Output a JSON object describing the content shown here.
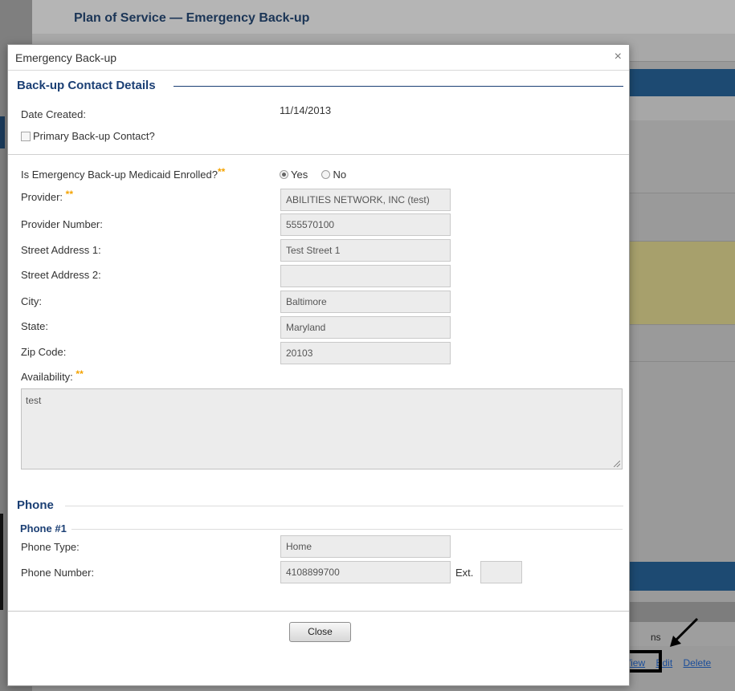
{
  "background": {
    "page_title": "Plan of Service — Emergency Back-up",
    "column_header_fragment": "ns",
    "row_links": {
      "view": "k View",
      "edit": "Edit",
      "delete": "Delete"
    }
  },
  "modal": {
    "title": "Emergency Back-up",
    "close_icon": "×",
    "section_contact": "Back-up Contact Details",
    "date_created_label": "Date Created:",
    "date_created_value": "11/14/2013",
    "primary_label": "Primary Back-up Contact?",
    "medicaid_label": "Is Emergency Back-up Medicaid Enrolled?",
    "required_mark": "**",
    "radio_yes": "Yes",
    "radio_no": "No",
    "radio_selected": "Yes",
    "fields": {
      "provider_label": "Provider:",
      "provider_value": "ABILITIES NETWORK, INC (test)",
      "provider_number_label": "Provider Number:",
      "provider_number_value": "555570100",
      "street1_label": "Street Address 1:",
      "street1_value": "Test Street 1",
      "street2_label": "Street Address 2:",
      "street2_value": "",
      "city_label": "City:",
      "city_value": "Baltimore",
      "state_label": "State:",
      "state_value": "Maryland",
      "zip_label": "Zip Code:",
      "zip_value": "20103",
      "availability_label": "Availability:",
      "availability_value": "test"
    },
    "section_phone": "Phone",
    "phone_subsection": "Phone #1",
    "phone_type_label": "Phone Type:",
    "phone_type_value": "Home",
    "phone_number_label": "Phone Number:",
    "phone_number_value": "4108899700",
    "ext_label": "Ext.",
    "ext_value": "",
    "close_button": "Close"
  },
  "colors": {
    "heading_blue": "#1b3f74",
    "required_orange": "#f4a300",
    "readonly_field": "#ececec"
  }
}
